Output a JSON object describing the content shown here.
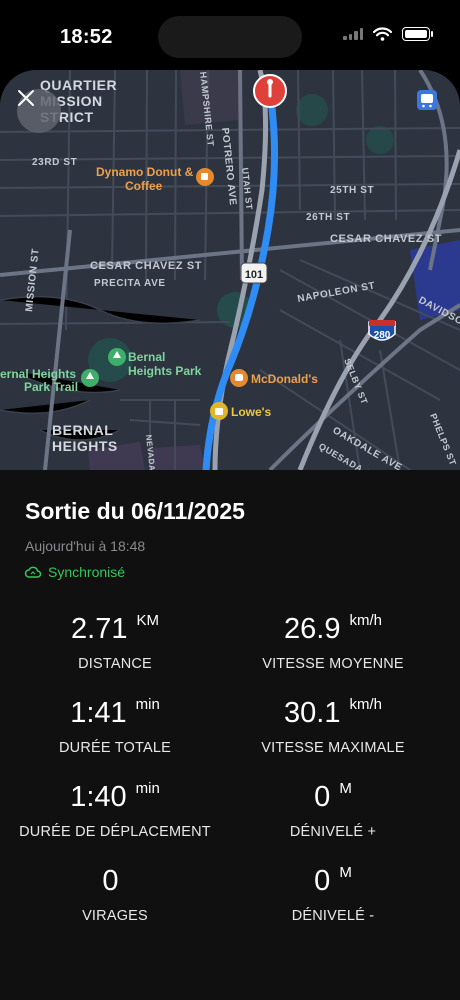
{
  "status_bar": {
    "time": "18:52"
  },
  "ride": {
    "title": "Sortie du 06/11/2025",
    "subtitle": "Aujourd'hui à 18:48",
    "sync_status": "Synchronisé"
  },
  "stats": [
    {
      "value": "2.71",
      "unit": "KM",
      "label": "DISTANCE"
    },
    {
      "value": "26.9",
      "unit": "km/h",
      "label": "VITESSE MOYENNE"
    },
    {
      "value": "1:41",
      "unit": "min",
      "label": "DURÉE TOTALE"
    },
    {
      "value": "30.1",
      "unit": "km/h",
      "label": "VITESSE MAXIMALE"
    },
    {
      "value": "1:40",
      "unit": "min",
      "label": "DURÉE DE DÉPLACEMENT"
    },
    {
      "value": "0",
      "unit": "M",
      "label": "DÉNIVELÉ +"
    },
    {
      "value": "0",
      "unit": "",
      "label": "VIRAGES"
    },
    {
      "value": "0",
      "unit": "M",
      "label": "DÉNIVELÉ -"
    }
  ],
  "map": {
    "route_color": "#2f8cf4",
    "labels": {
      "district_1": "QUARTIER",
      "district_2": "MISSION",
      "district_3": "STRICT",
      "bernal_1": "BERNAL",
      "bernal_2": "HEIGHTS",
      "s_23rd": "23RD ST",
      "s_25th": "25TH ST",
      "s_26th": "26TH ST",
      "cesar_e": "CESAR CHAVEZ ST",
      "cesar_w": "CESAR CHAVEZ ST",
      "precita": "PRECITA AVE",
      "napoleon": "NAPOLEON ST",
      "davidson": "DAVIDSON",
      "oakdale": "OAKDALE AVE",
      "quesada": "QUESADA AVE",
      "selby": "SELBY ST",
      "phelps": "PHELPS ST",
      "potrero": "POTRERO AVE",
      "utah": "UTAH ST",
      "hampshire": "HAMPSHIRE ST",
      "mission_st": "MISSION ST",
      "nevada": "NEVADA",
      "hwy101": "101",
      "hwy280": "280",
      "poi_dynamo_1": "Dynamo Donut &",
      "poi_dynamo_2": "Coffee",
      "poi_bernal_park_1": "Bernal",
      "poi_bernal_park_2": "Heights Park",
      "poi_trail_1": "ernal Heights",
      "poi_trail_2": "Park Trail",
      "poi_mcd": "McDonald's",
      "poi_lowes": "Lowe's"
    }
  }
}
